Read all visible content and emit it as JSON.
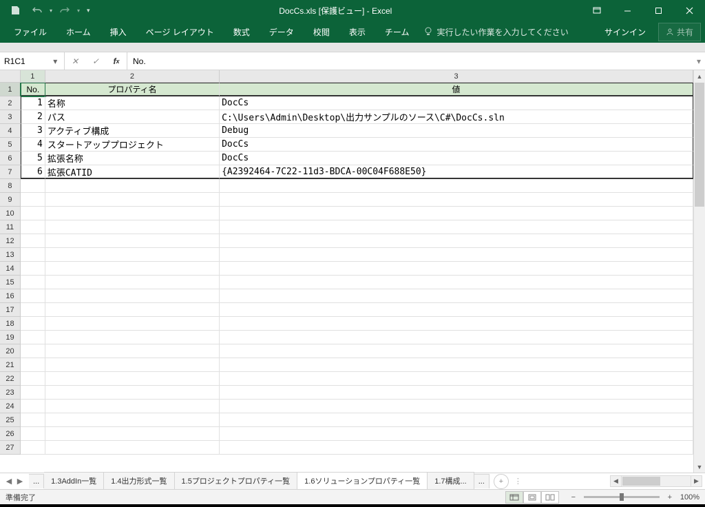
{
  "title": "DocCs.xls [保護ビュー] - Excel",
  "qat": {
    "save": "save",
    "undo": "undo",
    "redo": "redo"
  },
  "win": {
    "ribbon_opts": "⋯"
  },
  "ribbon": {
    "tabs": [
      "ファイル",
      "ホーム",
      "挿入",
      "ページ レイアウト",
      "数式",
      "データ",
      "校閲",
      "表示",
      "チーム"
    ],
    "tellme": "実行したい作業を入力してください",
    "signin": "サインイン",
    "share": "共有"
  },
  "formula": {
    "namebox": "R1C1",
    "content": "No."
  },
  "columns": [
    "1",
    "2",
    "3"
  ],
  "headers": {
    "c1": "No.",
    "c2": "プロパティ名",
    "c3": "値"
  },
  "data": [
    {
      "no": "1",
      "name": "名称",
      "value": "DocCs"
    },
    {
      "no": "2",
      "name": "パス",
      "value": "C:\\Users\\Admin\\Desktop\\出力サンプルのソース\\C#\\DocCs.sln"
    },
    {
      "no": "3",
      "name": "アクティブ構成",
      "value": "Debug"
    },
    {
      "no": "4",
      "name": "スタートアッププロジェクト",
      "value": "DocCs"
    },
    {
      "no": "5",
      "name": "拡張名称",
      "value": "DocCs"
    },
    {
      "no": "6",
      "name": "拡張CATID",
      "value": "{A2392464-7C22-11d3-BDCA-00C04F688E50}"
    }
  ],
  "empty_rows": [
    "8",
    "9",
    "10",
    "11",
    "12",
    "13",
    "14",
    "15",
    "16",
    "17",
    "18",
    "19",
    "20",
    "21",
    "22",
    "23",
    "24",
    "25",
    "26",
    "27"
  ],
  "sheets": {
    "tabs": [
      "1.3AddIn一覧",
      "1.4出力形式一覧",
      "1.5プロジェクトプロパティ一覧",
      "1.6ソリューションプロパティ一覧",
      "1.7構成..."
    ],
    "active": 3,
    "dots": "..."
  },
  "status": {
    "ready": "準備完了",
    "zoom": "100%"
  }
}
